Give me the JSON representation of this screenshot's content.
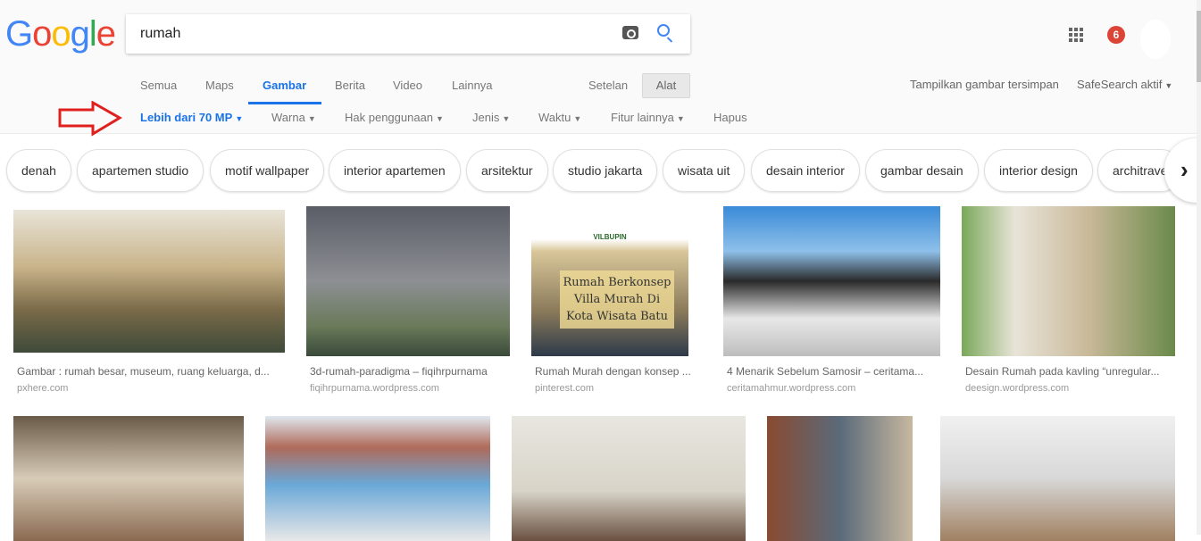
{
  "logo": "Google",
  "search": {
    "query": "rumah"
  },
  "tabs": [
    "Semua",
    "Maps",
    "Gambar",
    "Berita",
    "Video",
    "Lainnya"
  ],
  "active_tab": "Gambar",
  "settings": "Setelan",
  "tools": "Alat",
  "filters": [
    "Lebih dari 70 MP",
    "Warna",
    "Hak penggunaan",
    "Jenis",
    "Waktu",
    "Fitur lainnya"
  ],
  "clear": "Hapus",
  "notifications": "6",
  "saved_images": "Tampilkan gambar tersimpan",
  "safesearch": "SafeSearch aktif",
  "chips": [
    "denah",
    "apartemen studio",
    "motif wallpaper",
    "interior apartemen",
    "arsitektur",
    "studio jakarta",
    "wisata uit",
    "desain interior",
    "gambar desain",
    "interior design",
    "architrave"
  ],
  "results": [
    {
      "caption": "Gambar : rumah besar, museum, ruang keluarga, d...",
      "source": "pxhere.com"
    },
    {
      "caption": "3d-rumah-paradigma – fiqihrpurnama",
      "source": "fiqihrpurnama.wordpress.com"
    },
    {
      "caption": "Rumah Murah dengan konsep ...",
      "source": "pinterest.com",
      "image_text": "Rumah Berkonsep Villa Murah Di Kota Wisata Batu",
      "image_logo": "VILBUPIN"
    },
    {
      "caption": "4 Menarik Sebelum Samosir – ceritama...",
      "source": "ceritamahmur.wordpress.com"
    },
    {
      "caption": "Desain Rumah pada kavling “unregular...",
      "source": "deesign.wordpress.com"
    }
  ],
  "colors": {
    "accent": "#1a73e8",
    "badge": "#db4437",
    "arrow": "#e0201e"
  }
}
